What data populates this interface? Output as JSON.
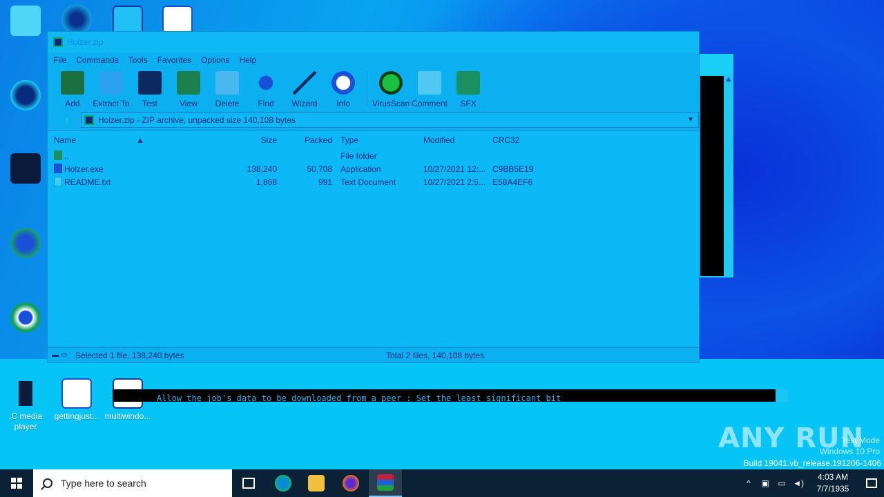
{
  "desktop": {
    "icons": [
      {
        "label": ""
      },
      {
        "label": ""
      },
      {
        "label": ""
      },
      {
        "label": ""
      },
      {
        "label": ""
      },
      {
        "label": ".C media player"
      },
      {
        "label": "gettingjust..."
      },
      {
        "label": "multiwindo..."
      }
    ]
  },
  "window": {
    "title": "Holzer.zip",
    "menu": [
      "File",
      "Commands",
      "Tools",
      "Favorites",
      "Options",
      "Help"
    ],
    "toolbar": [
      "Add",
      "Extract To",
      "Test",
      "View",
      "Delete",
      "Find",
      "Wizard",
      "Info",
      "VirusScan",
      "Comment",
      "SFX"
    ],
    "address": "Holzer.zip - ZIP archive, unpacked size 140,108 bytes",
    "columns": {
      "name": "Name",
      "size": "Size",
      "packed": "Packed",
      "type": "Type",
      "modified": "Modified",
      "crc": "CRC32"
    },
    "rows": [
      {
        "name": "..",
        "size": "",
        "packed": "",
        "type": "File folder",
        "modified": "",
        "crc": ""
      },
      {
        "name": "Holzer.exe",
        "size": "138,240",
        "packed": "50,708",
        "type": "Application",
        "modified": "10/27/2021 12:...",
        "crc": "C9BB5E19"
      },
      {
        "name": "README.txt",
        "size": "1,868",
        "packed": "991",
        "type": "Text Document",
        "modified": "10/27/2021 2:5...",
        "crc": "E58A4EF6"
      }
    ],
    "status_selected": "Selected 1 file, 138,240 bytes",
    "status_total": "Total 2 files, 140,108 bytes"
  },
  "console": {
    "text": "Allow the job's data to be downloaded from a peer : Set the least significant bit"
  },
  "watermark": {
    "brand": "ANY RUN",
    "test_mode": "Test Mode",
    "edition": "Windows 10 Pro",
    "build": "Build 19041.vb_release.191206-1406"
  },
  "taskbar": {
    "search_placeholder": "Type here to search",
    "time": "4:03 AM",
    "date": "7/7/1935"
  },
  "colors": {
    "accent": "#0cb0f0",
    "taskbar": "#0b2236"
  }
}
